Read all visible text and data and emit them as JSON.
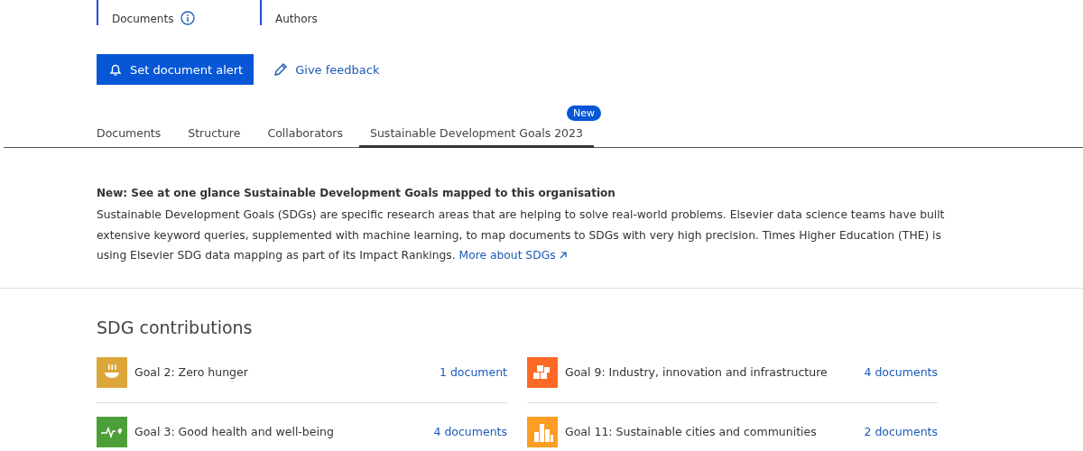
{
  "metrics": [
    {
      "label": "Documents",
      "info": true
    },
    {
      "label": "Authors",
      "info": false
    }
  ],
  "actions": {
    "alert_button": "Set document alert",
    "feedback_link": "Give feedback"
  },
  "tabs": [
    {
      "label": "Documents",
      "selected": false
    },
    {
      "label": "Structure",
      "selected": false
    },
    {
      "label": "Collaborators",
      "selected": false
    },
    {
      "label": "Sustainable Development Goals 2023",
      "selected": true,
      "badge": "New"
    }
  ],
  "intro": {
    "heading": "New: See at one glance Sustainable Development Goals mapped to this organisation",
    "text": "Sustainable Development Goals (SDGs) are specific research areas that are helping to solve real-world problems. Elsevier data science teams have built extensive keyword queries, supplemented with machine learning, to map documents to SDGs with very high precision. Times Higher Education (THE) is using Elsevier SDG data mapping as part of its Impact Rankings.",
    "link": "More about SDGs"
  },
  "sdg": {
    "title": "SDG contributions",
    "goals": [
      {
        "kind": "hunger",
        "label": "Goal 2: Zero hunger",
        "count": "1 document",
        "color": "#dda63a"
      },
      {
        "kind": "industry",
        "label": "Goal 9: Industry, innovation and infrastructure",
        "count": "4 documents",
        "color": "#fd6925"
      },
      {
        "kind": "health",
        "label": "Goal 3: Good health and well-being",
        "count": "4 documents",
        "color": "#4c9f38"
      },
      {
        "kind": "cities",
        "label": "Goal 11: Sustainable cities and communities",
        "count": "2 documents",
        "color": "#fd9d24"
      }
    ]
  }
}
